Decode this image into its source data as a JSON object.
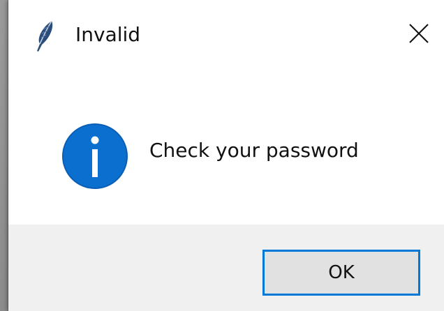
{
  "dialog": {
    "title": "Invalid",
    "message": "Check your password",
    "ok_label": "OK"
  },
  "icons": {
    "app": "feather-icon",
    "close": "close-icon",
    "message": "info-icon"
  },
  "colors": {
    "accent": "#0078d7",
    "button_face": "#e1e1e1",
    "button_area": "#f0f0f0"
  }
}
